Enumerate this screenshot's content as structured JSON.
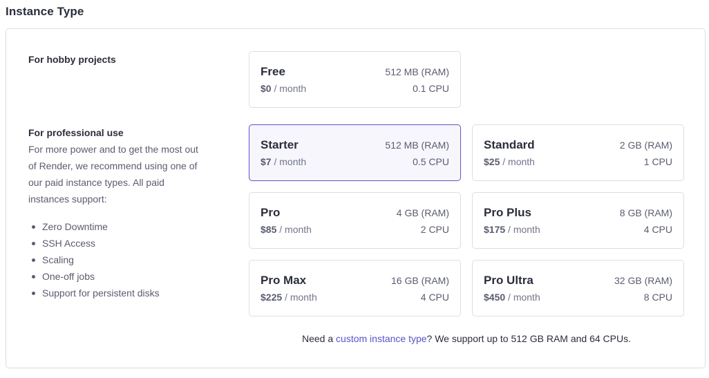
{
  "section_title": "Instance Type",
  "hobby": {
    "heading": "For hobby projects"
  },
  "professional": {
    "heading": "For professional use",
    "description": "For more power and to get the most out of Render, we recommend using one of our paid instance types. All paid instances support:",
    "features": [
      "Zero Downtime",
      "SSH Access",
      "Scaling",
      "One-off jobs",
      "Support for persistent disks"
    ]
  },
  "selected_plan": "Starter",
  "plans": [
    {
      "name": "Free",
      "price": "$0",
      "period": "/ month",
      "ram": "512 MB (RAM)",
      "cpu": "0.1 CPU"
    },
    {
      "name": "Starter",
      "price": "$7",
      "period": "/ month",
      "ram": "512 MB (RAM)",
      "cpu": "0.5 CPU"
    },
    {
      "name": "Standard",
      "price": "$25",
      "period": "/ month",
      "ram": "2 GB (RAM)",
      "cpu": "1 CPU"
    },
    {
      "name": "Pro",
      "price": "$85",
      "period": "/ month",
      "ram": "4 GB (RAM)",
      "cpu": "2 CPU"
    },
    {
      "name": "Pro Plus",
      "price": "$175",
      "period": "/ month",
      "ram": "8 GB (RAM)",
      "cpu": "4 CPU"
    },
    {
      "name": "Pro Max",
      "price": "$225",
      "period": "/ month",
      "ram": "16 GB (RAM)",
      "cpu": "4 CPU"
    },
    {
      "name": "Pro Ultra",
      "price": "$450",
      "period": "/ month",
      "ram": "32 GB (RAM)",
      "cpu": "8 CPU"
    }
  ],
  "footer": {
    "prefix": "Need a ",
    "link": "custom instance type",
    "suffix": "? We support up to 512 GB RAM and 64 CPUs."
  },
  "colors": {
    "accent": "#5b53c7",
    "selected_bg": "#f6f6fc",
    "border": "#dcdde8"
  }
}
